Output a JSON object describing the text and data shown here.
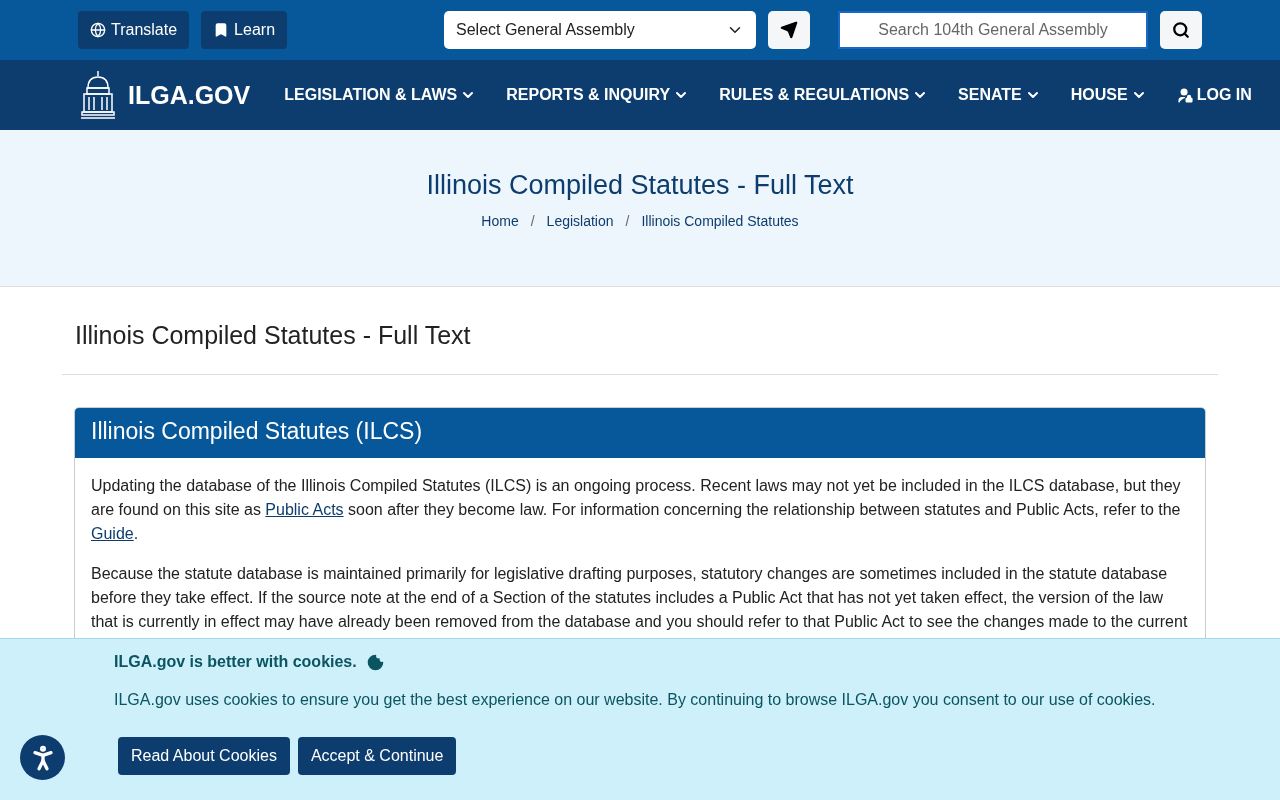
{
  "top_bar": {
    "buttons": [
      {
        "kind": "globe",
        "label": "Translate"
      },
      {
        "kind": "bookmark",
        "label": "Learn"
      }
    ],
    "assembly_select": {
      "value": "Select General Assembly"
    },
    "search": {
      "placeholder": "Search 104th General Assembly"
    }
  },
  "nav": {
    "logo": "ILGA.GOV",
    "items": [
      {
        "kind": "menu",
        "label": "LEGISLATION & LAWS"
      },
      {
        "kind": "menu",
        "label": "REPORTS & INQUIRY"
      },
      {
        "kind": "menu",
        "label": "RULES & REGULATIONS"
      },
      {
        "kind": "menu",
        "label": "SENATE"
      },
      {
        "kind": "menu",
        "label": "HOUSE"
      },
      {
        "kind": "login",
        "label": "LOG IN"
      }
    ]
  },
  "hero": {
    "title": "Illinois Compiled Statutes - Full Text",
    "breadcrumb": [
      "Home",
      "Legislation",
      "Illinois Compiled Statutes"
    ],
    "separator": "/"
  },
  "page_heading": "Illinois Compiled Statutes - Full Text",
  "card": {
    "title": "Illinois Compiled Statutes (ILCS)",
    "paragraphs": [
      [
        {
          "kind": "text",
          "text": "Updating the database of the Illinois Compiled Statutes (ILCS) is an ongoing process. Recent laws may not yet be included in the ILCS database, but they are found on this site as "
        },
        {
          "kind": "link",
          "text": "Public Acts"
        },
        {
          "kind": "text",
          "text": " soon after they become law. For information concerning the relationship between statutes and Public Acts, refer to the "
        },
        {
          "kind": "link",
          "text": "Guide"
        },
        {
          "kind": "text",
          "text": "."
        }
      ],
      [
        {
          "kind": "text",
          "text": "Because the statute database is maintained primarily for legislative drafting purposes, statutory changes are sometimes included in the statute database before they take effect. If the source note at the end of a Section of the statutes includes a Public Act that has not yet taken effect, the version of the law that is currently in effect may have already been removed from the database and you should refer to that Public Act to see the changes made to the current"
        }
      ]
    ]
  },
  "cookie_banner": {
    "title": "ILGA.gov is better with cookies.",
    "text": "ILGA.gov uses cookies to ensure you get the best experience on our website. By continuing to browse ILGA.gov you consent to our use of cookies.",
    "buttons": [
      "Read About Cookies",
      "Accept & Continue"
    ]
  }
}
